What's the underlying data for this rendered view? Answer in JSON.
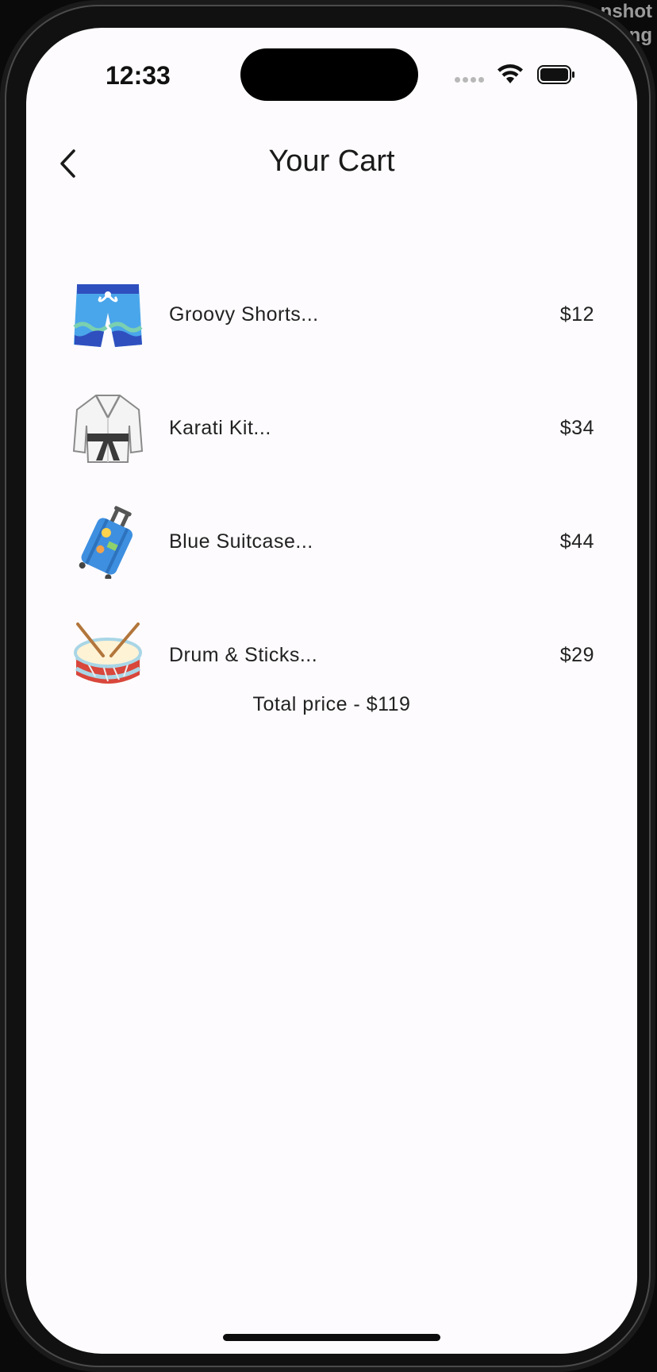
{
  "background_overlay": {
    "text_line_1": "nshot",
    "text_line_2": "eng"
  },
  "status_bar": {
    "time": "12:33",
    "wifi_icon": "wifi-icon",
    "battery_icon": "battery-icon"
  },
  "header": {
    "back_icon": "chevron-left-icon",
    "title": "Your Cart"
  },
  "cart": {
    "items": [
      {
        "name": "Groovy Shorts...",
        "price": "$12",
        "icon": "shorts-icon"
      },
      {
        "name": "Karati Kit...",
        "price": "$34",
        "icon": "karate-gi-icon"
      },
      {
        "name": "Blue Suitcase...",
        "price": "$44",
        "icon": "suitcase-icon"
      },
      {
        "name": "Drum & Sticks...",
        "price": "$29",
        "icon": "drum-icon"
      }
    ],
    "total_text": "Total price - $119"
  },
  "colors": {
    "screen_background": "#fdfbfd",
    "text": "#222222"
  }
}
